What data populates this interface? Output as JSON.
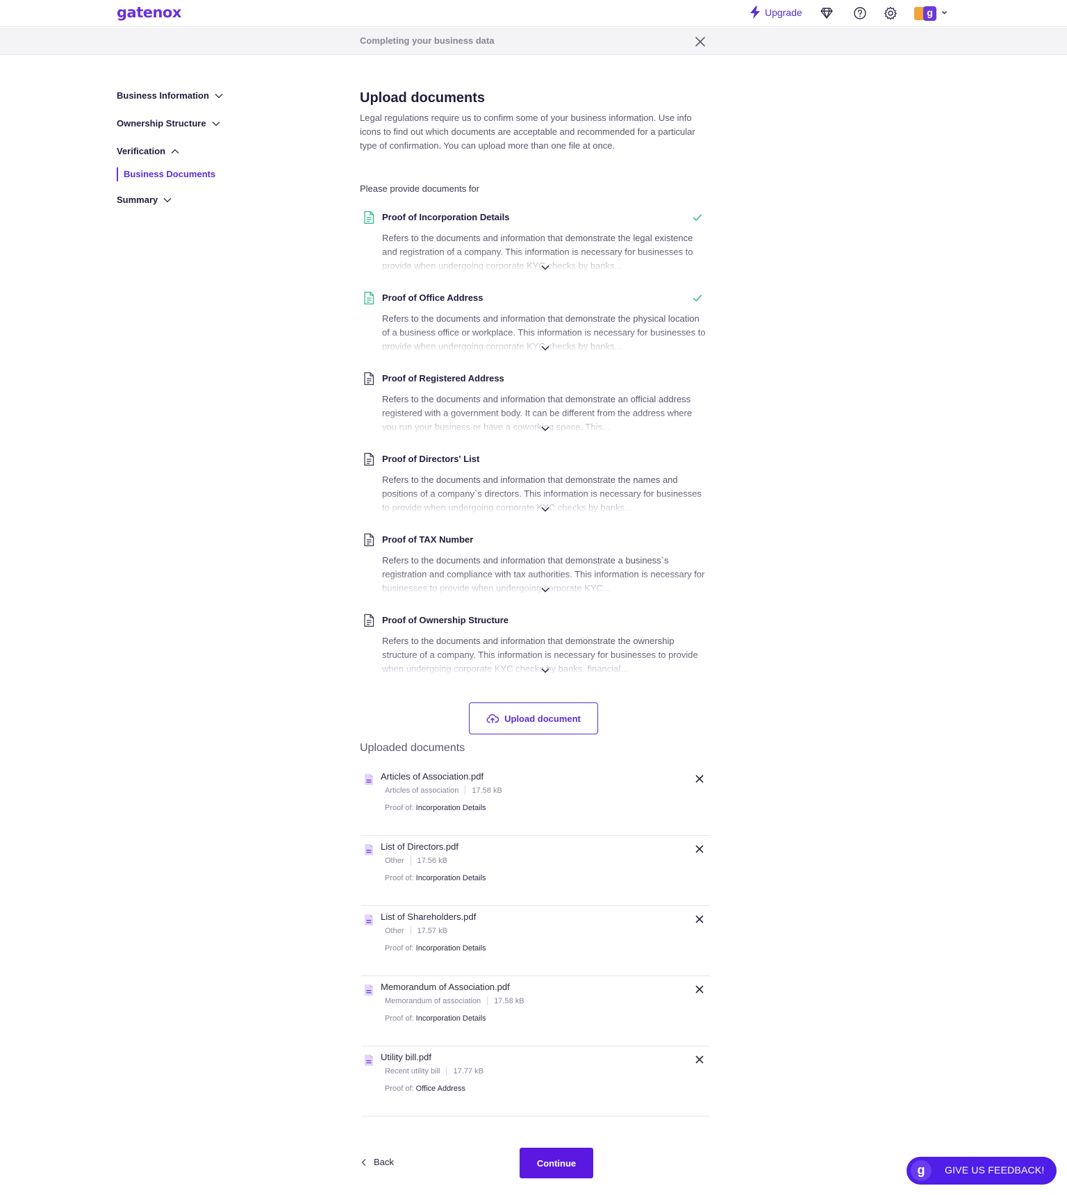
{
  "nav": {
    "logo": "gatenox",
    "upgrade": "Upgrade",
    "avatar_letter": "g",
    "icons": [
      "diamond-icon",
      "help-icon",
      "settings-icon"
    ]
  },
  "subheader": {
    "title": "Completing your business data"
  },
  "sidebar": {
    "items": [
      {
        "label": "Business Information",
        "state": "collapsed"
      },
      {
        "label": "Ownership Structure",
        "state": "collapsed"
      },
      {
        "label": "Verification",
        "state": "expanded"
      },
      {
        "label": "Summary",
        "state": "collapsed"
      }
    ],
    "active_sub": "Business Documents"
  },
  "main": {
    "title": "Upload documents",
    "intro": "Legal regulations require us to confirm some of your business information. Use info icons to find out which documents are acceptable and recommended for a particular type of confirmation. You can upload more than one file at once.",
    "provide_label": "Please provide documents for",
    "proofs": [
      {
        "title": "Proof of Incorporation Details",
        "complete": true,
        "desc": "Refers to the documents and information that demonstrate the legal existence and registration of a company. This information is necessary for businesses to provide when undergoing corporate KYC checks by banks..."
      },
      {
        "title": "Proof of Office Address",
        "complete": true,
        "desc": "Refers to the documents and information that demonstrate the physical location of a business office or workplace. This information is necessary for businesses to provide when undergoing corporate KYC checks by banks..."
      },
      {
        "title": "Proof of Registered Address",
        "complete": false,
        "desc": "Refers to the documents and information that demonstrate an official address registered with a government body. It can be different from the address where you run your business or have a coworking space. This..."
      },
      {
        "title": "Proof of Directors' List",
        "complete": false,
        "desc": "Refers to the documents and information that demonstrate the names and positions of a company`s directors. This information is necessary for businesses to provide when undergoing corporate KYC checks by banks..."
      },
      {
        "title": "Proof of TAX Number",
        "complete": false,
        "desc": "Refers to the documents and information that demonstrate a business`s registration and compliance with tax authorities. This information is necessary for businesses to provide when undergoing corporate KYC..."
      },
      {
        "title": "Proof of Ownership Structure",
        "complete": false,
        "desc": "Refers to the documents and information that demonstrate the ownership structure of a company. This information is necessary for businesses to provide when undergoing corporate KYC checks by banks, financial..."
      }
    ],
    "upload_button": "Upload document",
    "uploaded_title": "Uploaded documents",
    "proof_of_label": "Proof of: ",
    "files": [
      {
        "name": "Articles of Association.pdf",
        "type": "Articles of association",
        "size": "17.58 kB",
        "proof_of": "Incorporation Details"
      },
      {
        "name": "List of Directors.pdf",
        "type": "Other",
        "size": "17.56 kB",
        "proof_of": "Incorporation Details"
      },
      {
        "name": "List of Shareholders.pdf",
        "type": "Other",
        "size": "17.57 kB",
        "proof_of": "Incorporation Details"
      },
      {
        "name": "Memorandum of Association.pdf",
        "type": "Memorandum of association",
        "size": "17.58 kB",
        "proof_of": "Incorporation Details"
      },
      {
        "name": "Utility bill.pdf",
        "type": "Recent utility bill",
        "size": "17.77 kB",
        "proof_of": "Office Address"
      }
    ]
  },
  "footer": {
    "back": "Back",
    "continue": "Continue",
    "feedback": "GIVE US FEEDBACK!",
    "feedback_logo": "g"
  },
  "colors": {
    "brand": "#5a18e0",
    "accent_text": "#5a2ed6",
    "success": "#2fb88a",
    "feedback_bg": "#4f1ee8"
  }
}
